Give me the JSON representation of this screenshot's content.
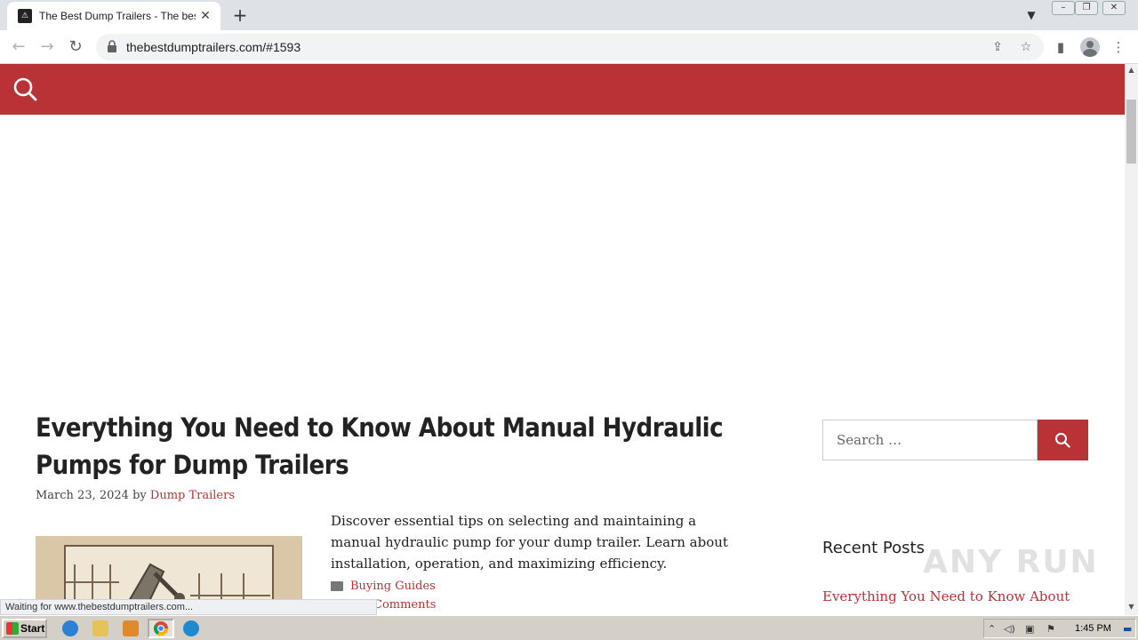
{
  "browser": {
    "tab_title": "The Best Dump Trailers - The best du",
    "tab_favicon": "alert-triangle-icon",
    "url": "thebestdumptrailers.com/#1593",
    "status_text": "Waiting for www.thebestdumptrailers.com..."
  },
  "site": {
    "header_color": "#b83236",
    "accent_color": "#b83236"
  },
  "article": {
    "title": "Everything You Need to Know About Manual Hydraulic Pumps for Dump Trailers",
    "date": "March 23, 2024",
    "by": "by",
    "author": "Dump Trailers",
    "excerpt": "Discover essential tips on selecting and maintaining a manual hydraulic pump for your dump trailer. Learn about installation, operation, and maximizing efficiency.",
    "category": "Buying Guides",
    "comments": "Comments"
  },
  "sidebar": {
    "search_placeholder": "Search …",
    "recent_heading": "Recent Posts",
    "recent_posts": [
      "Everything You Need to Know About"
    ]
  },
  "watermark": "ANY RUN",
  "taskbar": {
    "start_label": "Start",
    "clock": "1:45 PM"
  }
}
